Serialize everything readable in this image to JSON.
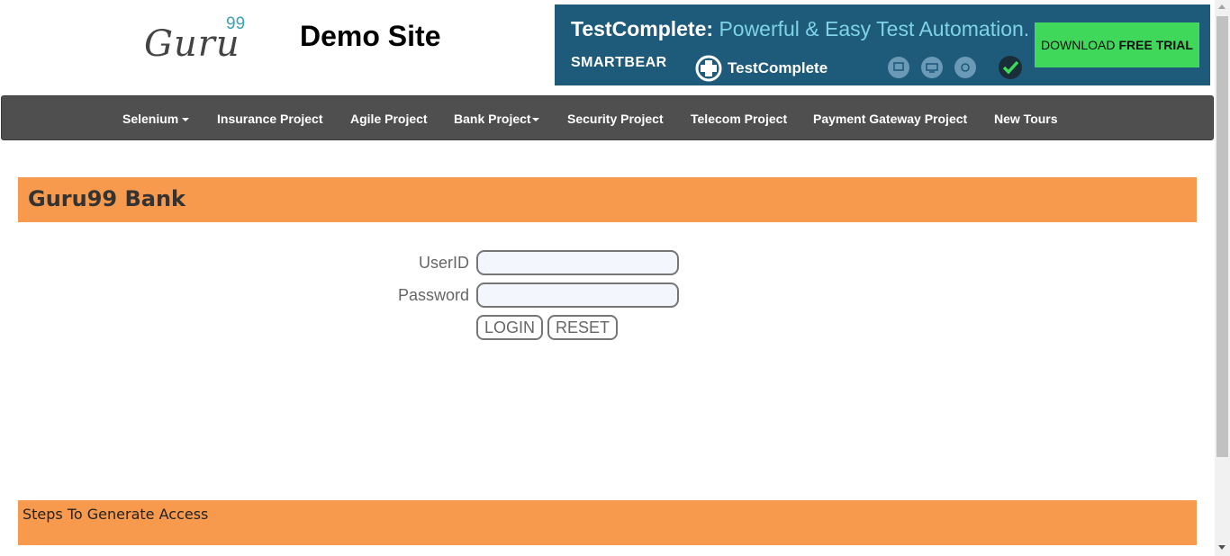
{
  "header": {
    "logo_word": "Guru",
    "logo_num": "99",
    "site_title": "Demo Site"
  },
  "banner": {
    "head_bold": "TestComplete:",
    "head_light": "Powerful & Easy Test Automation.",
    "brand": "SMARTBEAR",
    "product": "TestComplete",
    "cta_normal": "DOWNLOAD",
    "cta_bold": "FREE TRIAL",
    "icons": [
      "desktop-icon",
      "web-icon",
      "mobile-icon"
    ],
    "accent": "#3fd85a",
    "background": "#1e5a7a"
  },
  "nav": {
    "items": [
      {
        "label": "Selenium",
        "dropdown": true
      },
      {
        "label": "Insurance Project",
        "dropdown": false
      },
      {
        "label": "Agile Project",
        "dropdown": false
      },
      {
        "label": "Bank Project",
        "dropdown": true
      },
      {
        "label": "Security Project",
        "dropdown": false
      },
      {
        "label": "Telecom Project",
        "dropdown": false
      },
      {
        "label": "Payment Gateway Project",
        "dropdown": false
      },
      {
        "label": "New Tours",
        "dropdown": false
      }
    ]
  },
  "main": {
    "bank_title": "Guru99 Bank",
    "userid_label": "UserID",
    "userid_value": "",
    "password_label": "Password",
    "password_value": "",
    "login_label": "LOGIN",
    "reset_label": "RESET",
    "steps_title": "Steps To Generate Access",
    "bar_color": "#f79a4e"
  }
}
